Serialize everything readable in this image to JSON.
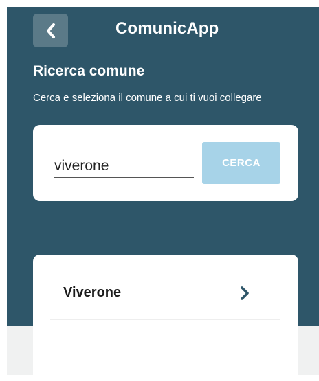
{
  "header": {
    "title": "ComunicApp",
    "back_icon": "chevron-left-icon"
  },
  "search_section": {
    "title": "Ricerca comune",
    "description": "Cerca e seleziona il comune a cui ti vuoi collegare"
  },
  "search": {
    "value": "viverone",
    "button_label": "CERCA"
  },
  "results": [
    {
      "label": "Viverone",
      "icon": "chevron-right-icon"
    }
  ],
  "colors": {
    "primary_bg": "#2e5669",
    "back_button_bg": "#5b7a88",
    "button_bg": "#a7d3e8",
    "lower_bg": "#f0f1f1",
    "chevron": "#2e5669"
  }
}
